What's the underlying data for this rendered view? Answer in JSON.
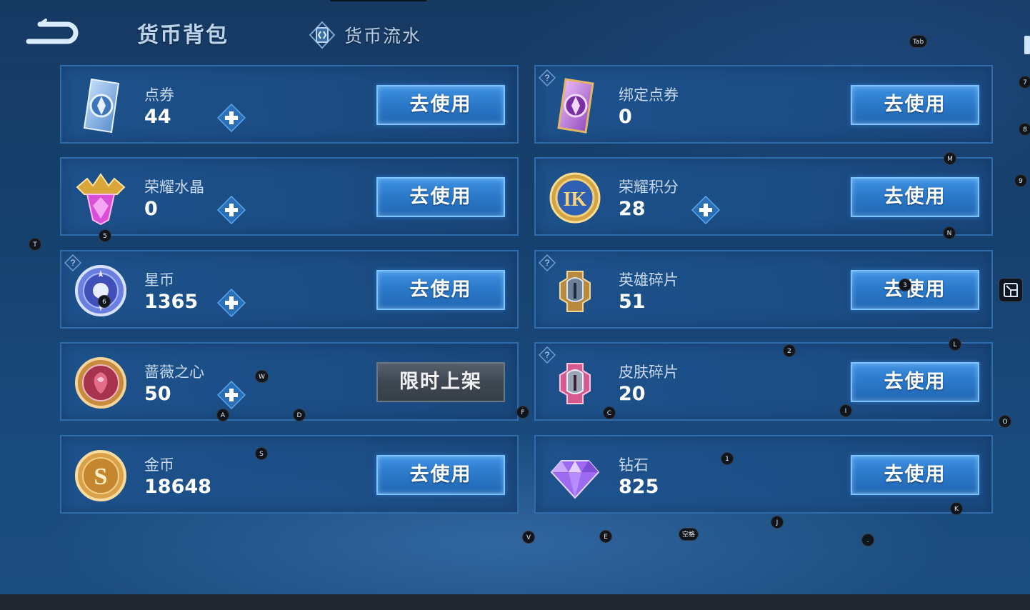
{
  "header": {
    "tab_backpack": "货币背包",
    "tab_flow": "货币流水"
  },
  "cards": [
    {
      "name": "点券",
      "amount": "44",
      "action": "去使用",
      "has_plus": true,
      "has_help": false,
      "icon": "voucher-icon"
    },
    {
      "name": "绑定点券",
      "amount": "0",
      "action": "去使用",
      "has_plus": false,
      "has_help": true,
      "icon": "bound-voucher-icon"
    },
    {
      "name": "荣耀水晶",
      "amount": "0",
      "action": "去使用",
      "has_plus": true,
      "has_help": false,
      "icon": "glory-crystal-icon"
    },
    {
      "name": "荣耀积分",
      "amount": "28",
      "action": "去使用",
      "has_plus": true,
      "has_help": false,
      "icon": "glory-points-icon"
    },
    {
      "name": "星币",
      "amount": "1365",
      "action": "去使用",
      "has_plus": true,
      "has_help": true,
      "icon": "star-coin-icon"
    },
    {
      "name": "英雄碎片",
      "amount": "51",
      "action": "去使用",
      "has_plus": false,
      "has_help": true,
      "icon": "hero-fragment-icon"
    },
    {
      "name": "蔷薇之心",
      "amount": "50",
      "action": "限时上架",
      "has_plus": true,
      "has_help": false,
      "icon": "rose-heart-icon"
    },
    {
      "name": "皮肤碎片",
      "amount": "20",
      "action": "去使用",
      "has_plus": false,
      "has_help": true,
      "icon": "skin-fragment-icon"
    },
    {
      "name": "金币",
      "amount": "18648",
      "action": "去使用",
      "has_plus": false,
      "has_help": false,
      "icon": "gold-coin-icon"
    },
    {
      "name": "钻石",
      "amount": "825",
      "action": "去使用",
      "has_plus": false,
      "has_help": false,
      "icon": "diamond-icon"
    }
  ],
  "key_hints": {
    "tab": "Tab",
    "k7": "7",
    "k8": "8",
    "k9": "9",
    "m": "M",
    "n": "N",
    "t": "T",
    "k5": "5",
    "k6": "6",
    "k3": "3",
    "k2": "2",
    "l": "L",
    "w": "W",
    "a": "A",
    "d": "D",
    "f": "F",
    "c": "C",
    "i": "I",
    "o": "O",
    "s": "S",
    "k1": "1",
    "j": "J",
    "k": "K",
    "v": "V",
    "e": "E",
    "space": "空格",
    "dot": "."
  }
}
